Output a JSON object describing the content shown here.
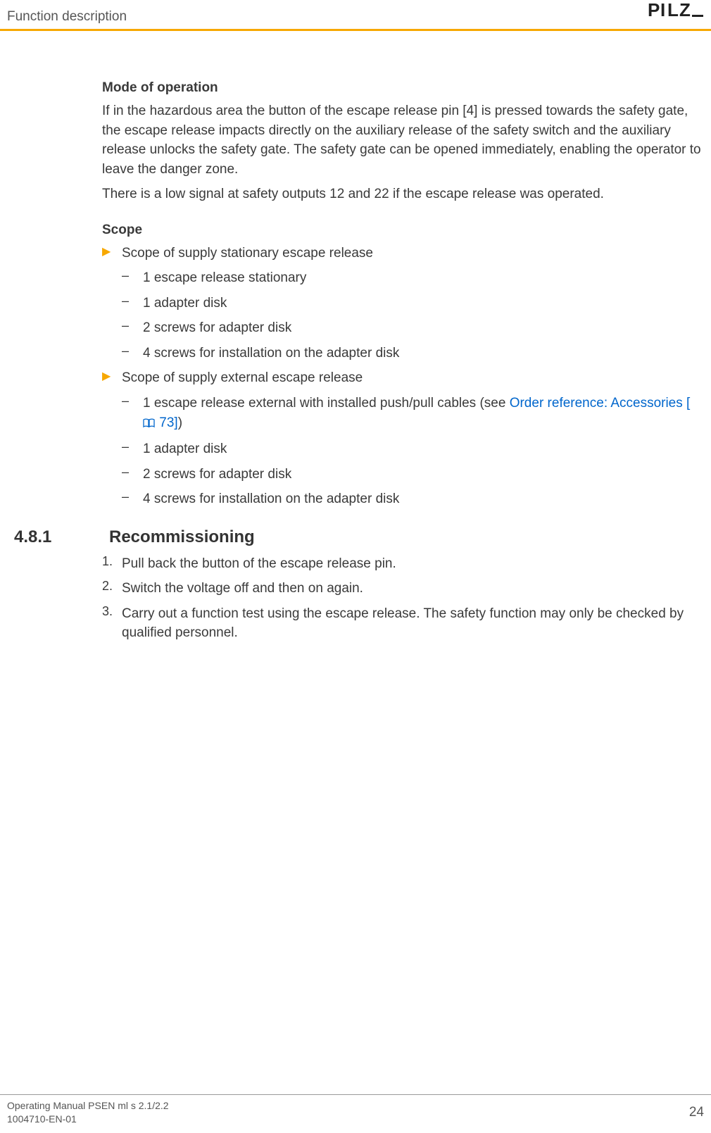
{
  "header": {
    "title": "Function description",
    "logo": "PILZ"
  },
  "section1": {
    "heading": "Mode of operation",
    "p1": "If in the hazardous area the button of the escape release pin [4] is pressed towards the safety gate, the escape release impacts directly on the auxiliary release of the safety switch and the auxiliary release unlocks the safety gate. The safety gate can be opened immediately, enabling the operator to leave the danger zone.",
    "p2": "There is a low signal at safety outputs 12 and 22 if the escape release was operated."
  },
  "section2": {
    "heading": "Scope",
    "b1": {
      "label": "Scope of supply stationary escape release",
      "items": [
        "1 escape release stationary",
        "1 adapter disk",
        "2 screws for adapter disk",
        "4 screws for installation on the adapter disk"
      ]
    },
    "b2": {
      "label": "Scope of supply external escape release",
      "items": {
        "pre": "1 escape release external with installed push/pull cables (see ",
        "link": "Order reference: Accessories [",
        "page": " 73]",
        "post": ")",
        "i2": "1 adapter disk",
        "i3": "2 screws for adapter disk",
        "i4": "4 screws for installation on the adapter disk"
      }
    }
  },
  "section3": {
    "number": "4.8.1",
    "title": "Recommissioning",
    "steps": [
      "Pull back the button of the escape release pin.",
      "Switch the voltage off and then on again.",
      "Carry out a function test using the escape release. The safety function may only be checked by qualified personnel."
    ]
  },
  "footer": {
    "line1": "Operating Manual PSEN ml s 2.1/2.2",
    "line2": "1004710-EN-01",
    "page": "24"
  }
}
